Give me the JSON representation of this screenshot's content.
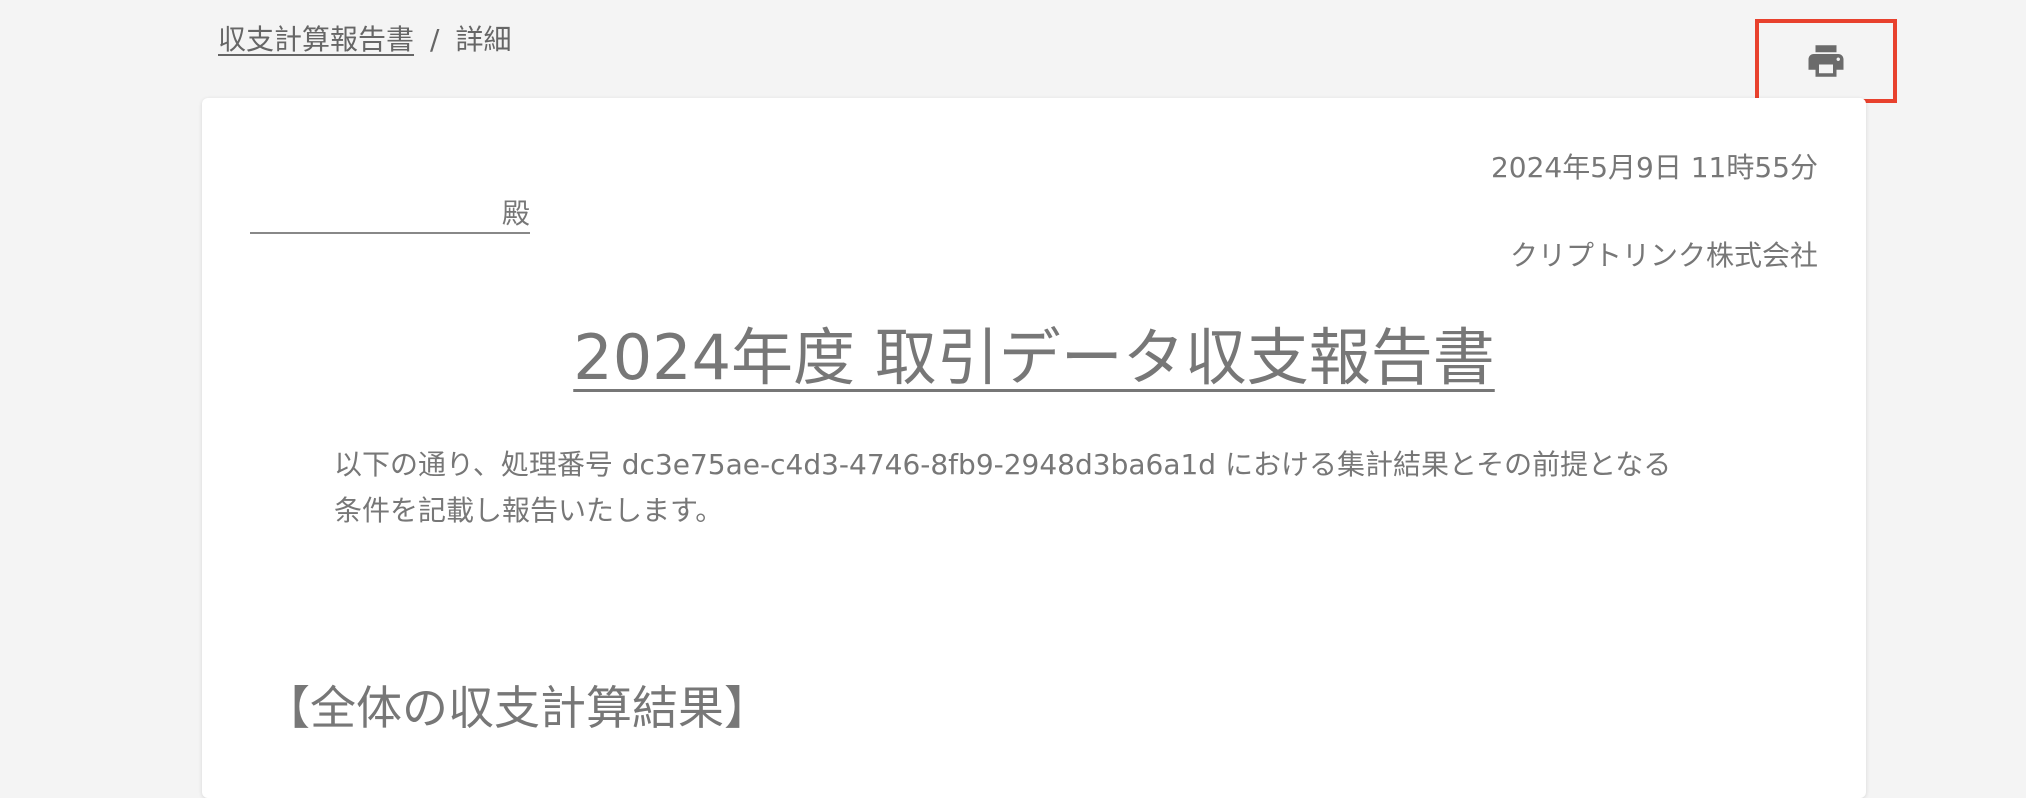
{
  "breadcrumb": {
    "parent_label": "収支計算報告書",
    "separator": "/",
    "current_label": "詳細"
  },
  "toolbar": {
    "print_icon": "printer-icon",
    "highlight_color": "#e8412d"
  },
  "report": {
    "date": "2024年5月9日 11時55分",
    "addressee_suffix": "殿",
    "company": "クリプトリンク株式会社",
    "title": "2024年度 取引データ収支報告書",
    "intro_line1": "以下の通り、処理番号 dc3e75ae-c4d3-4746-8fb9-2948d3ba6a1d における集計結果とその前提となる",
    "intro_line2": "条件を記載し報告いたします。",
    "section_heading": "【全体の収支計算結果】"
  }
}
